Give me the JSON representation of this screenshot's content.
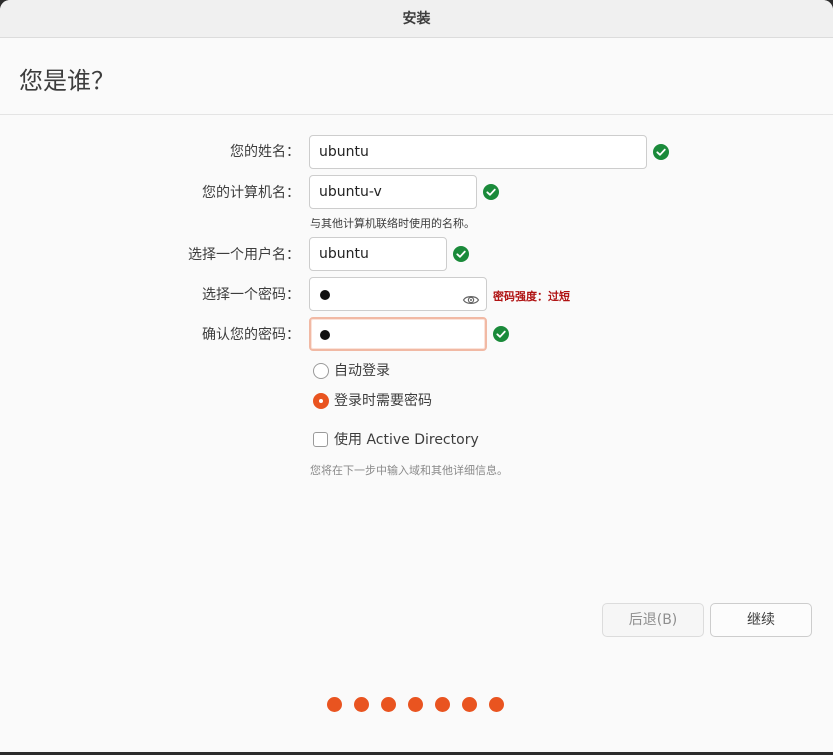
{
  "window": {
    "title": "安装"
  },
  "page": {
    "heading": "您是谁？"
  },
  "form": {
    "name": {
      "label": "您的姓名：",
      "value": "ubuntu"
    },
    "computer": {
      "label": "您的计算机名：",
      "value": "ubuntu-v",
      "hint": "与其他计算机联络时使用的名称。"
    },
    "username": {
      "label": "选择一个用户名：",
      "value": "ubuntu"
    },
    "password": {
      "label": "选择一个密码：",
      "strength": "密码强度：过短"
    },
    "confirm": {
      "label": "确认您的密码："
    }
  },
  "login": {
    "auto_label": "自动登录",
    "auto_selected": false,
    "require_label": "登录时需要密码",
    "require_selected": true
  },
  "active_directory": {
    "label": "使用 Active Directory",
    "checked": false,
    "hint": "您将在下一步中输入域和其他详细信息。"
  },
  "buttons": {
    "back": "后退(B)",
    "continue": "继续"
  },
  "progress": {
    "steps_shown": 7
  },
  "colors": {
    "accent": "#e95420",
    "success": "#1a8a3a",
    "warning": "#b01313"
  },
  "icons": {
    "valid": "check-circle-icon",
    "reveal": "eye-icon"
  }
}
